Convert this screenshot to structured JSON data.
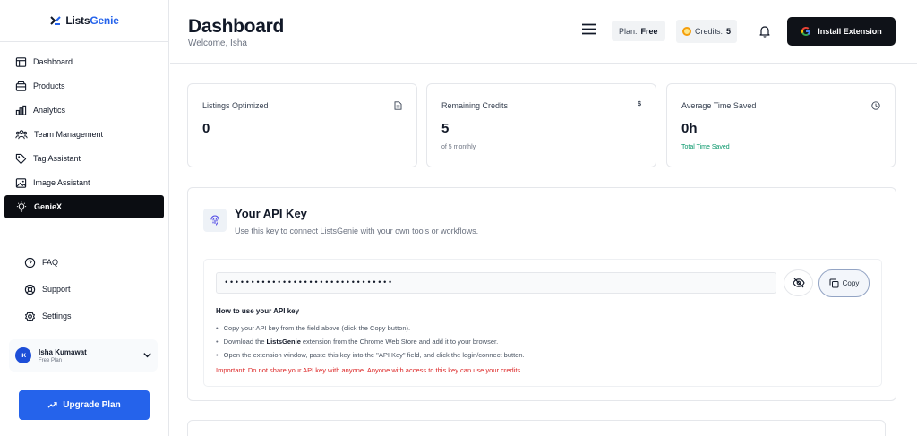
{
  "brand": {
    "logo_part1": "Lists",
    "logo_part2": "Genie"
  },
  "sidebar": {
    "items": [
      {
        "label": "Dashboard",
        "icon": "dashboard-icon"
      },
      {
        "label": "Products",
        "icon": "box-icon"
      },
      {
        "label": "Analytics",
        "icon": "bar-chart-icon"
      },
      {
        "label": "Team Management",
        "icon": "team-icon"
      },
      {
        "label": "Tag Assistant",
        "icon": "tag-icon"
      },
      {
        "label": "Image Assistant",
        "icon": "image-icon"
      },
      {
        "label": "GenieX",
        "icon": "lightbulb-icon",
        "active": true
      }
    ],
    "secondary": [
      {
        "label": "FAQ",
        "icon": "help-circle-icon"
      },
      {
        "label": "Support",
        "icon": "lifebuoy-icon"
      },
      {
        "label": "Settings",
        "icon": "gear-icon"
      }
    ],
    "user": {
      "initials": "IK",
      "name": "Isha Kumawat",
      "plan": "Free Plan"
    },
    "upgrade_label": "Upgrade Plan"
  },
  "header": {
    "title": "Dashboard",
    "welcome": "Welcome, Isha",
    "plan_label": "Plan:",
    "plan_value": "Free",
    "credits_label": "Credits:",
    "credits_value": "5",
    "install_label": "Install Extension"
  },
  "stats": [
    {
      "label": "Listings Optimized",
      "value": "0",
      "sub": "",
      "icon": "document-icon"
    },
    {
      "label": "Remaining Credits",
      "value": "5",
      "sub": "of 5 monthly",
      "icon": "dollar-icon",
      "icon_text": "$"
    },
    {
      "label": "Average Time Saved",
      "value": "0h",
      "sub": "Total Time Saved",
      "icon": "clock-icon"
    }
  ],
  "api": {
    "title": "Your API Key",
    "subtitle": "Use this key to connect ListsGenie with your own tools or workflows.",
    "masked_key": "••••••••••••••••••••••••••••••••",
    "copy_label": "Copy",
    "howto_title": "How to use your API key",
    "step1": "Copy your API key from the field above (click the Copy button).",
    "step2_pre": "Download the",
    "step2_brand": "ListsGenie",
    "step2_post": "extension from the Chrome Web Store and add it to your browser.",
    "step3": "Open the extension window, paste this key into the \"API Key\" field, and click the login/connect button.",
    "warning": "Important: Do not share your API key with anyone. Anyone with access to this key can use your credits."
  },
  "colors": {
    "accent": "#2563eb",
    "active_nav": "#0b0d12",
    "warning": "#dc2626",
    "success": "#059669"
  }
}
